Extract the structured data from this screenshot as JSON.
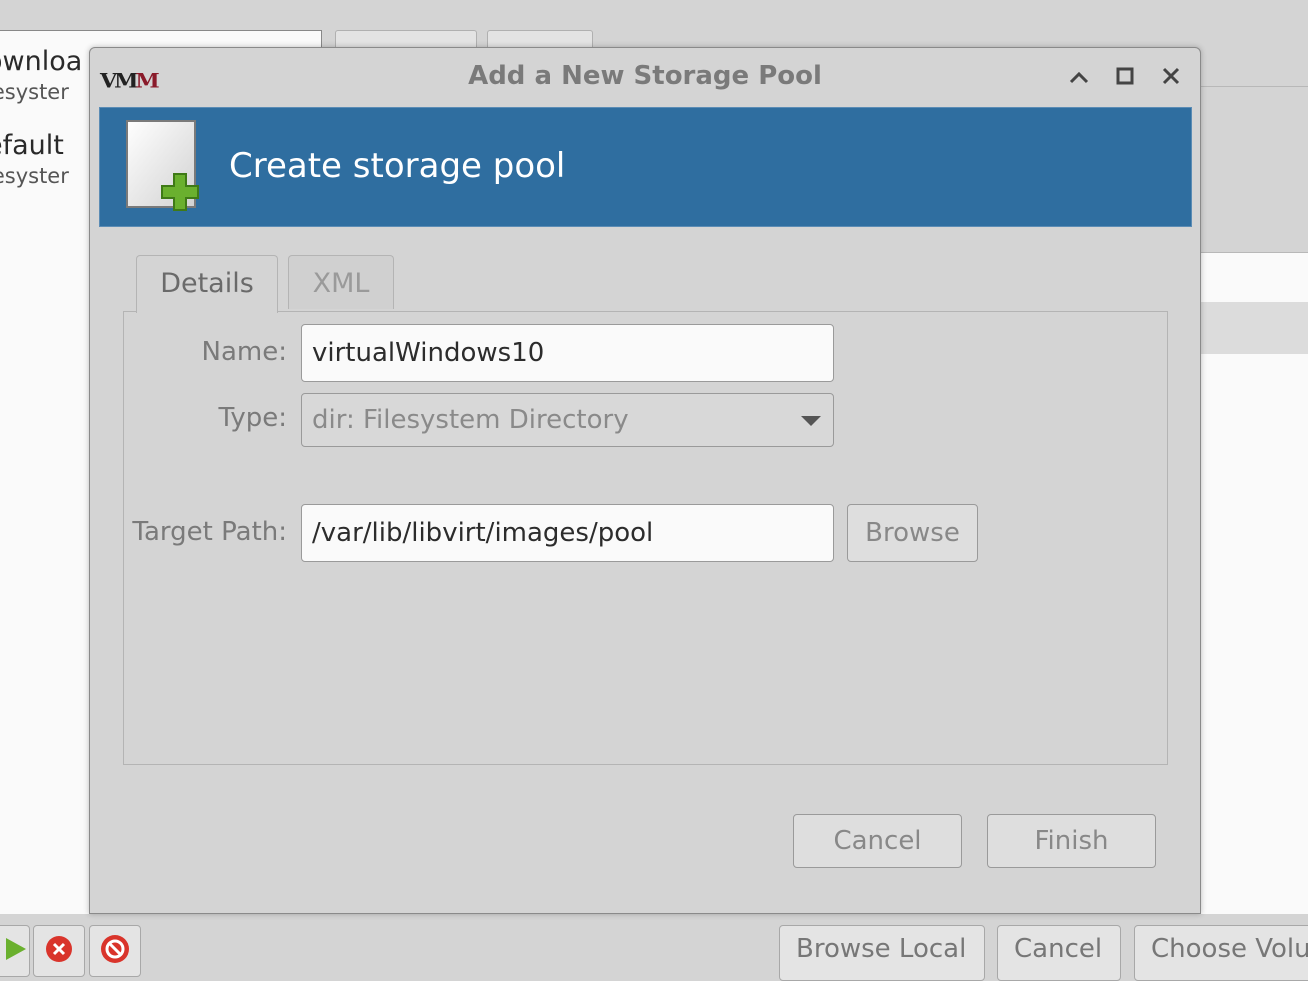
{
  "background": {
    "list_items": [
      {
        "name": "ownloa",
        "type": "lesyster"
      },
      {
        "name": "efault",
        "type": "lesyster"
      }
    ],
    "bottom_buttons": {
      "browse_local": "Browse Local",
      "cancel": "Cancel",
      "choose_volume": "Choose Volu"
    }
  },
  "dialog": {
    "title": "Add a New Storage Pool",
    "banner_title": "Create storage pool",
    "tabs": [
      {
        "label": "Details",
        "active": true
      },
      {
        "label": "XML",
        "active": false
      }
    ],
    "fields": {
      "name_label": "Name:",
      "name_value": "virtualWindows10",
      "type_label": "Type:",
      "type_value": "dir: Filesystem Directory",
      "target_path_label": "Target Path:",
      "target_path_value": "/var/lib/libvirt/images/pool",
      "browse_label": "Browse"
    },
    "buttons": {
      "cancel": "Cancel",
      "finish": "Finish"
    }
  },
  "colors": {
    "banner": "#2f6ea0",
    "window_bg": "#d4d4d4",
    "plus_icon": "#6ab02e"
  },
  "icons": [
    "vm-logo-icon",
    "minimize-icon",
    "maximize-icon",
    "close-icon",
    "new-document-icon",
    "play-icon",
    "stop-icon",
    "delete-icon",
    "dropdown-arrow-icon"
  ]
}
